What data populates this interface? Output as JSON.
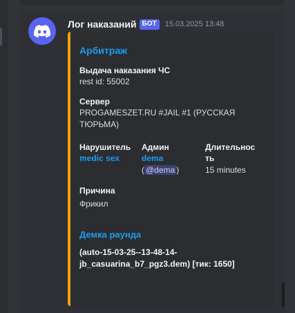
{
  "message": {
    "username": "Лог наказаний",
    "bot_tag": "БОТ",
    "timestamp": "15.03.2025 13:48"
  },
  "embed": {
    "title": "Арбитраж",
    "accent_color": "#f0a30a",
    "fields": {
      "issue": {
        "name": "Выдача наказания ЧС",
        "value": "rest id: 55002"
      },
      "server": {
        "name": "Сервер",
        "value_line1": "PROGAMESZET.RU #JAIL #1 (РУССКАЯ",
        "value_line2": "ТЮРЬМА)"
      },
      "violator": {
        "name": "Нарушитель",
        "value": "medic sex"
      },
      "admin": {
        "name": "Админ",
        "value": "dema",
        "mention_open": "(",
        "mention": "@dema",
        "mention_close": ")"
      },
      "duration": {
        "name_line1": "Длительнос",
        "name_line2": "ть",
        "value": "15 minutes"
      },
      "reason": {
        "name": "Причина",
        "value": "Фрикил"
      }
    },
    "demo": {
      "title": "Демка раунда",
      "file_line1": "(auto-15-03-25--13-48-14-",
      "file_line2": "jb_casuarina_b7_pgz3.dem) [тик: 1650]"
    }
  },
  "icons": {
    "avatar": "discord-logo-icon"
  },
  "colors": {
    "link": "#1e9bf0",
    "bot_tag": "#5865f2",
    "avatar_bg": "#5865f2"
  }
}
